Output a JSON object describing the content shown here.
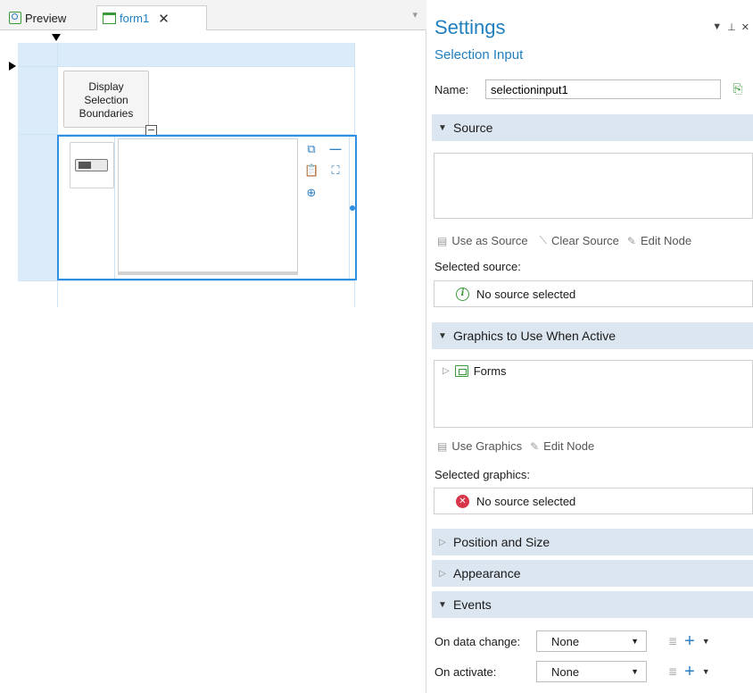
{
  "tabs": {
    "preview_label": "Preview",
    "form_label": "form1"
  },
  "canvas": {
    "button_label_line1": "Display",
    "button_label_line2": "Selection",
    "button_label_line3": "Boundaries"
  },
  "settings": {
    "title": "Settings",
    "subtitle": "Selection Input",
    "name_label": "Name:",
    "name_value": "selectioninput1"
  },
  "source_section": {
    "header": "Source",
    "use_as_source": "Use as Source",
    "clear_source": "Clear Source",
    "edit_node": "Edit Node",
    "selected_label": "Selected source:",
    "status_text": "No source selected"
  },
  "graphics_section": {
    "header": "Graphics to Use When Active",
    "tree_item": "Forms",
    "use_graphics": "Use Graphics",
    "edit_node": "Edit Node",
    "selected_label": "Selected graphics:",
    "status_text": "No source selected"
  },
  "collapsed_sections": {
    "position": "Position and Size",
    "appearance": "Appearance"
  },
  "events_section": {
    "header": "Events",
    "rows": [
      {
        "label": "On data change:",
        "value": "None"
      },
      {
        "label": "On activate:",
        "value": "None"
      }
    ]
  },
  "colors": {
    "accent": "#1f7fbf",
    "section_bg": "#dbe6f1",
    "selection_border": "#2f8fe0",
    "error": "#d7354a",
    "success": "#3a9a3a"
  }
}
